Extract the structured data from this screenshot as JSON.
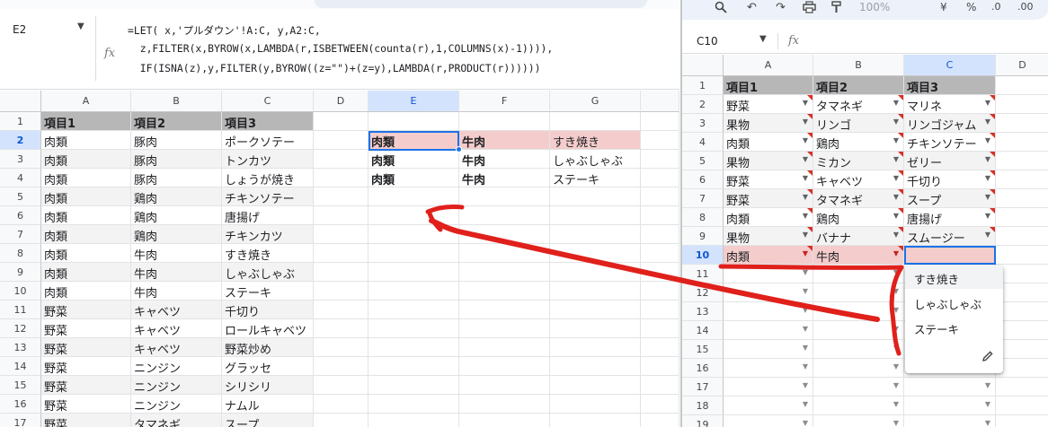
{
  "left": {
    "name_box": "E2",
    "formula_lines": [
      "=LET( x,'プルダウン'!A:C, y,A2:C,",
      "  z,FILTER(x,BYROW(x,LAMBDA(r,ISBETWEEN(counta(r),1,COLUMNS(x)-1)))),",
      "  IF(ISNA(z),y,FILTER(y,BYROW((z=\"\")+(z=y),LAMBDA(r,PRODUCT(r))))))"
    ],
    "fx_label": "fx",
    "columns": [
      "A",
      "B",
      "C",
      "D",
      "E",
      "F",
      "G"
    ],
    "rows": [
      {
        "num": "1",
        "a": "項目1",
        "b": "項目2",
        "c": "項目3",
        "e": "",
        "f": "",
        "g": ""
      },
      {
        "num": "2",
        "a": "肉類",
        "b": "豚肉",
        "c": "ポークソテー",
        "e": "肉類",
        "f": "牛肉",
        "g": "すき焼き"
      },
      {
        "num": "3",
        "a": "肉類",
        "b": "豚肉",
        "c": "トンカツ",
        "e": "肉類",
        "f": "牛肉",
        "g": "しゃぶしゃぶ"
      },
      {
        "num": "4",
        "a": "肉類",
        "b": "豚肉",
        "c": "しょうが焼き",
        "e": "肉類",
        "f": "牛肉",
        "g": "ステーキ"
      },
      {
        "num": "5",
        "a": "肉類",
        "b": "鶏肉",
        "c": "チキンソテー",
        "e": "",
        "f": "",
        "g": ""
      },
      {
        "num": "6",
        "a": "肉類",
        "b": "鶏肉",
        "c": "唐揚げ",
        "e": "",
        "f": "",
        "g": ""
      },
      {
        "num": "7",
        "a": "肉類",
        "b": "鶏肉",
        "c": "チキンカツ",
        "e": "",
        "f": "",
        "g": ""
      },
      {
        "num": "8",
        "a": "肉類",
        "b": "牛肉",
        "c": "すき焼き",
        "e": "",
        "f": "",
        "g": ""
      },
      {
        "num": "9",
        "a": "肉類",
        "b": "牛肉",
        "c": "しゃぶしゃぶ",
        "e": "",
        "f": "",
        "g": ""
      },
      {
        "num": "10",
        "a": "肉類",
        "b": "牛肉",
        "c": "ステーキ",
        "e": "",
        "f": "",
        "g": ""
      },
      {
        "num": "11",
        "a": "野菜",
        "b": "キャベツ",
        "c": "千切り",
        "e": "",
        "f": "",
        "g": ""
      },
      {
        "num": "12",
        "a": "野菜",
        "b": "キャベツ",
        "c": "ロールキャベツ",
        "e": "",
        "f": "",
        "g": ""
      },
      {
        "num": "13",
        "a": "野菜",
        "b": "キャベツ",
        "c": "野菜炒め",
        "e": "",
        "f": "",
        "g": ""
      },
      {
        "num": "14",
        "a": "野菜",
        "b": "ニンジン",
        "c": "グラッセ",
        "e": "",
        "f": "",
        "g": ""
      },
      {
        "num": "15",
        "a": "野菜",
        "b": "ニンジン",
        "c": "シリシリ",
        "e": "",
        "f": "",
        "g": ""
      },
      {
        "num": "16",
        "a": "野菜",
        "b": "ニンジン",
        "c": "ナムル",
        "e": "",
        "f": "",
        "g": ""
      },
      {
        "num": "17",
        "a": "野菜",
        "b": "タマネギ",
        "c": "スープ",
        "e": "",
        "f": "",
        "g": ""
      }
    ]
  },
  "right": {
    "zoom": "100%",
    "name_box": "C10",
    "fx_label": "fx",
    "toolbar_icons": [
      "search-icon",
      "undo-icon",
      "redo-icon",
      "print-icon",
      "paint-format-icon"
    ],
    "toolbar_symbols": {
      "currency": "¥",
      "percent": "%",
      "dec_decrease": ".0",
      "dec_increase": ".00"
    },
    "columns": [
      "A",
      "B",
      "C",
      "D"
    ],
    "rows": [
      {
        "num": "1",
        "a": "項目1",
        "b": "項目2",
        "c": "項目3"
      },
      {
        "num": "2",
        "a": "野菜",
        "b": "タマネギ",
        "c": "マリネ"
      },
      {
        "num": "3",
        "a": "果物",
        "b": "リンゴ",
        "c": "リンゴジャム"
      },
      {
        "num": "4",
        "a": "肉類",
        "b": "鶏肉",
        "c": "チキンソテー"
      },
      {
        "num": "5",
        "a": "果物",
        "b": "ミカン",
        "c": "ゼリー"
      },
      {
        "num": "6",
        "a": "野菜",
        "b": "キャベツ",
        "c": "千切り"
      },
      {
        "num": "7",
        "a": "野菜",
        "b": "タマネギ",
        "c": "スープ"
      },
      {
        "num": "8",
        "a": "肉類",
        "b": "鶏肉",
        "c": "唐揚げ"
      },
      {
        "num": "9",
        "a": "果物",
        "b": "バナナ",
        "c": "スムージー"
      },
      {
        "num": "10",
        "a": "肉類",
        "b": "牛肉",
        "c": ""
      },
      {
        "num": "11",
        "a": "",
        "b": "",
        "c": ""
      },
      {
        "num": "12",
        "a": "",
        "b": "",
        "c": ""
      },
      {
        "num": "13",
        "a": "",
        "b": "",
        "c": ""
      },
      {
        "num": "14",
        "a": "",
        "b": "",
        "c": ""
      },
      {
        "num": "15",
        "a": "",
        "b": "",
        "c": ""
      },
      {
        "num": "16",
        "a": "",
        "b": "",
        "c": ""
      },
      {
        "num": "17",
        "a": "",
        "b": "",
        "c": ""
      },
      {
        "num": "18",
        "a": "",
        "b": "",
        "c": ""
      },
      {
        "num": "19",
        "a": "",
        "b": "",
        "c": ""
      }
    ],
    "dropdown_options": [
      "すき焼き",
      "しゃぶしゃぶ",
      "ステーキ"
    ],
    "edit_icon": "pencil-icon"
  },
  "colors": {
    "header_fill": "#b7b7b7",
    "band_fill": "#f3f3f3",
    "highlight_fill": "#f4cccc",
    "selection": "#1a73e8",
    "annotation": "#e0201b"
  }
}
